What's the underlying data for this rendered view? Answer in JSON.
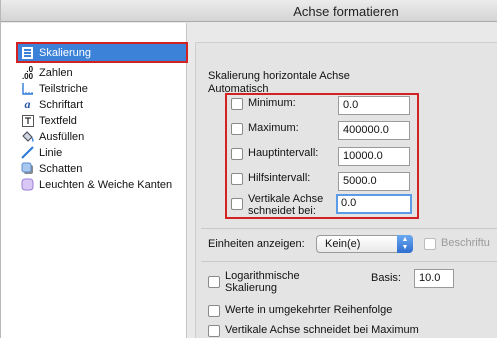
{
  "window": {
    "title": "Achse formatieren"
  },
  "sidebar": {
    "items": [
      {
        "label": "Skalierung",
        "icon": "scaling-icon",
        "selected": true
      },
      {
        "label": "Zahlen",
        "icon": "number-format-icon"
      },
      {
        "label": "Teilstriche",
        "icon": "tick-marks-icon"
      },
      {
        "label": "Schriftart",
        "icon": "font-icon"
      },
      {
        "label": "Textfeld",
        "icon": "textbox-icon"
      },
      {
        "label": "Ausfüllen",
        "icon": "fill-bucket-icon"
      },
      {
        "label": "Linie",
        "icon": "line-icon"
      },
      {
        "label": "Schatten",
        "icon": "shadow-icon"
      },
      {
        "label": "Leuchten & Weiche Kanten",
        "icon": "glow-icon"
      }
    ],
    "icon_glyphs": {
      "number": ".0\n.00"
    }
  },
  "scaling": {
    "section_title": "Skalierung horizontale Achse",
    "auto_label": "Automatisch",
    "rows": [
      {
        "label": "Minimum:",
        "value": "0.0"
      },
      {
        "label": "Maximum:",
        "value": "400000.0"
      },
      {
        "label": "Hauptintervall:",
        "value": "10000.0"
      },
      {
        "label": "Hilfsintervall:",
        "value": "5000.0"
      },
      {
        "label": "Vertikale Achse",
        "label2": "schneidet bei:",
        "value": "0.0"
      }
    ]
  },
  "units": {
    "label": "Einheiten anzeigen:",
    "selected": "Kein(e)",
    "caption_label": "Beschriftu"
  },
  "options": {
    "log_label": "Logarithmische",
    "log_label2": "Skalierung",
    "basis_label": "Basis:",
    "basis_value": "10.0",
    "reverse_label": "Werte in umgekehrter Reihenfolge",
    "cross_max_label": "Vertikale Achse schneidet bei Maximum"
  },
  "colors": {
    "selection": "#3b82d8",
    "highlight": "#d42222",
    "focus": "#5b9be8"
  }
}
